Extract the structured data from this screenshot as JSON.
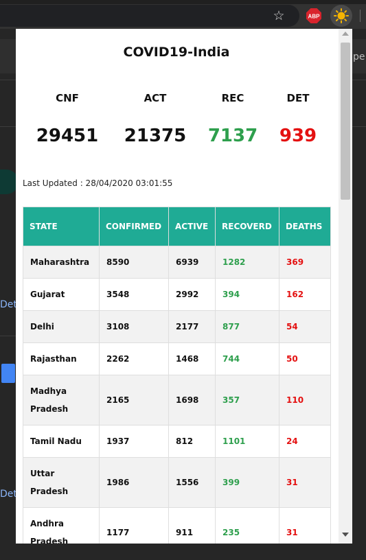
{
  "browser": {
    "star_icon": "star-icon",
    "adblock_label": "ABP",
    "extension_icon": "covid-sun-icon",
    "background_partial_text": "pe",
    "background_link_text": "Det"
  },
  "popup": {
    "title": "COVID19-India",
    "stats": [
      {
        "label": "CNF",
        "value": "29451",
        "color": "#111111"
      },
      {
        "label": "ACT",
        "value": "21375",
        "color": "#111111"
      },
      {
        "label": "REC",
        "value": "7137",
        "color": "#2e9f4d"
      },
      {
        "label": "DET",
        "value": "939",
        "color": "#e41111"
      }
    ],
    "last_updated": "Last Updated : 28/04/2020 03:01:55",
    "table": {
      "headers": [
        "STATE",
        "CONFIRMED",
        "ACTIVE",
        "RECOVERD",
        "DEATHS"
      ],
      "rows": [
        {
          "state": "Maharashtra",
          "confirmed": "8590",
          "active": "6939",
          "recovered": "1282",
          "deaths": "369"
        },
        {
          "state": "Gujarat",
          "confirmed": "3548",
          "active": "2992",
          "recovered": "394",
          "deaths": "162"
        },
        {
          "state": "Delhi",
          "confirmed": "3108",
          "active": "2177",
          "recovered": "877",
          "deaths": "54"
        },
        {
          "state": "Rajasthan",
          "confirmed": "2262",
          "active": "1468",
          "recovered": "744",
          "deaths": "50"
        },
        {
          "state": "Madhya Pradesh",
          "confirmed": "2165",
          "active": "1698",
          "recovered": "357",
          "deaths": "110"
        },
        {
          "state": "Tamil Nadu",
          "confirmed": "1937",
          "active": "812",
          "recovered": "1101",
          "deaths": "24"
        },
        {
          "state": "Uttar Pradesh",
          "confirmed": "1986",
          "active": "1556",
          "recovered": "399",
          "deaths": "31"
        },
        {
          "state": "Andhra Pradesh",
          "confirmed": "1177",
          "active": "911",
          "recovered": "235",
          "deaths": "31"
        }
      ]
    },
    "colors": {
      "header_bg": "#1fab95",
      "recovered": "#2e9f4d",
      "deaths": "#e41111"
    }
  }
}
